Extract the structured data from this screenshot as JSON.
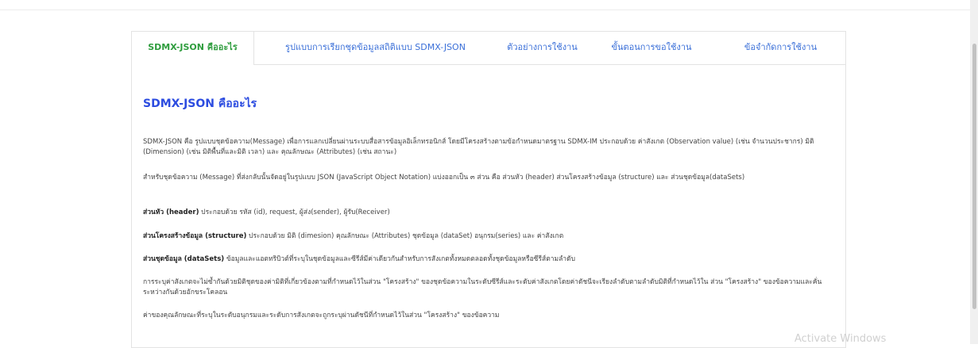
{
  "tabs": [
    {
      "label": "SDMX-JSON คืออะไร",
      "active": true
    },
    {
      "label": "รูปแบบการเรียกชุดข้อมูลสถิติแบบ SDMX-JSON",
      "active": false
    },
    {
      "label": "ตัวอย่างการใช้งาน",
      "active": false
    },
    {
      "label": "ขั้นตอนการขอใช้งาน",
      "active": false
    },
    {
      "label": "ข้อจำกัดการใช้งาน",
      "active": false
    }
  ],
  "content": {
    "heading": "SDMX-JSON คืออะไร",
    "p1": "SDMX-JSON คือ รูปแบบชุดข้อความ(Message) เพื่อการแลกเปลี่ยนผ่านระบบสื่อสารข้อมูลอิเล็กทรอนิกส์ โดยมีโครงสร้างตามข้อกำหนดมาตรฐาน SDMX-IM ประกอบด้วย ค่าสังเกต (Observation value) (เช่น จำนวนประชากร) มิติ (Dimension) (เช่น มิติพื้นที่และมิติ เวลา) และ คุณลักษณะ (Attributes) (เช่น สถานะ)",
    "p2": "สำหรับชุดข้อความ (Message) ที่ส่งกลับนั้นจัดอยู่ในรูปแบบ JSON (JavaScript Object Notation) แบ่งออกเป็น ๓ ส่วน คือ ส่วนหัว (header) ส่วนโครงสร้างข้อมูล (structure) และ ส่วนชุดข้อมูล(dataSets)",
    "p3_bold": "ส่วนหัว (header)",
    "p3_text": " ประกอบด้วย รหัส (id), request, ผู้ส่ง(sender), ผู้รับ(Receiver)",
    "p4_bold": "ส่วนโครงสร้างข้อมูล (structure)",
    "p4_text": " ประกอบด้วย มิติ (dimesion) คุณลักษณะ (Attributes) ชุดข้อมูล (dataSet) อนุกรม(series) และ ค่าสังเกต",
    "p5_bold": "ส่วนชุดข้อมูล (dataSets)",
    "p5_text": " ข้อมูลและแอตทริบิวต์ที่ระบุในชุดข้อมูลและซีรีส์มีค่าเดียวกันสำหรับการสังเกตทั้งหมดตลอดทั้งชุดข้อมูลหรือซีรีส์ตามลำดับ",
    "p6": "การระบุค่าสังเกตจะไม่ซ้ำกันด้วยมิติชุดของค่ามิติที่เกี่ยวข้องตามที่กำหนดไว้ในส่วน \"โครงสร้าง\" ของชุดข้อความในระดับซีรีส์และระดับค่าสังเกตโดยค่าดัชนีจะเรียงลำดับตามลำดับมิติที่กำหนดไว้ใน ส่วน \"โครงสร้าง\" ของข้อความและคั่นระหว่างกันด้วยอักขระโคลอน",
    "p7": "ค่าของคุณลักษณะที่ระบุในระดับอนุกรมและระดับการสังเกตจะถูกระบุผ่านดัชนีที่กำหนดไว้ในส่วน \"โครงสร้าง\" ของข้อความ"
  },
  "watermark": "Activate Windows"
}
